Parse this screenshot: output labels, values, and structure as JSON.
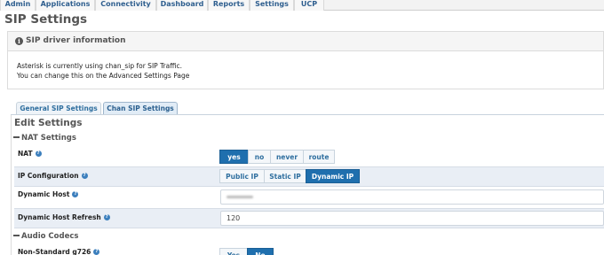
{
  "nav": {
    "tabs": [
      "Admin",
      "Applications",
      "Connectivity",
      "Dashboard",
      "Reports",
      "Settings",
      "UCP"
    ]
  },
  "page_title": "SIP Settings",
  "info_panel": {
    "title": "SIP driver information",
    "line1": "Asterisk is currently using chan_sip for SIP Traffic.",
    "line2": "You can change this on the Advanced Settings Page"
  },
  "tabs": [
    "General SIP Settings",
    "Chan SIP Settings"
  ],
  "active_tab": "Chan SIP Settings",
  "edit_title": "Edit Settings",
  "nat_section": "NAT Settings",
  "nat": {
    "label": "NAT",
    "options": [
      "yes",
      "no",
      "never",
      "route"
    ],
    "selected": "yes"
  },
  "ip_config": {
    "label": "IP Configuration",
    "options": [
      "Public IP",
      "Static IP",
      "Dynamic IP"
    ],
    "selected": "Dynamic IP"
  },
  "dynamic_host": {
    "label": "Dynamic Host",
    "value_obscured": true
  },
  "dynamic_host_refresh": {
    "label": "Dynamic Host Refresh",
    "value": "120"
  },
  "audio_section": "Audio Codecs",
  "g726": {
    "label": "Non-Standard g726",
    "options": [
      "Yes",
      "No"
    ],
    "selected": "No"
  },
  "colors": {
    "accent": "#1f6fae",
    "tab_text": "#2f6f9f",
    "help_icon": "#3c7fbd",
    "row_shade": "#e9eef5"
  },
  "icons": {
    "info": "info-circle-icon",
    "help": "question-circle-icon",
    "collapse": "minus-icon"
  }
}
